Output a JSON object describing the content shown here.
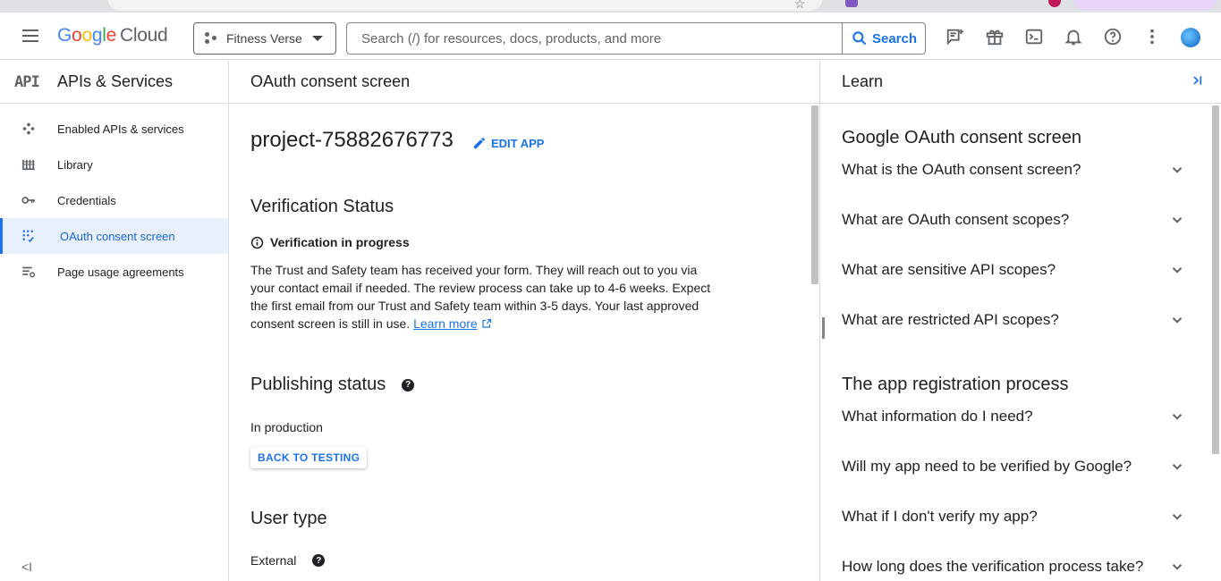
{
  "header": {
    "logo_google": [
      "G",
      "o",
      "o",
      "g",
      "l",
      "e"
    ],
    "logo_cloud": "Cloud",
    "project_name": "Fitness Verse",
    "search_placeholder": "Search (/) for resources, docs, products, and more",
    "search_button": "Search"
  },
  "sidenav": {
    "title": "APIs & Services",
    "api_glyph": "API",
    "items": [
      {
        "label": "Enabled APIs & services",
        "icon": "hub-icon"
      },
      {
        "label": "Library",
        "icon": "library-icon"
      },
      {
        "label": "Credentials",
        "icon": "key-icon"
      },
      {
        "label": "OAuth consent screen",
        "icon": "consent-icon",
        "active": true
      },
      {
        "label": "Page usage agreements",
        "icon": "settings-list-icon"
      }
    ],
    "collapse_glyph": "<I"
  },
  "main": {
    "page_title": "OAuth consent screen",
    "app_name": "project-75882676773",
    "edit_app": "EDIT APP",
    "verification_heading": "Verification Status",
    "verification_state": "Verification in progress",
    "verification_text": "The Trust and Safety team has received your form. They will reach out to you via your contact email if needed. The review process can take up to 4-6 weeks. Expect the first email from our Trust and Safety team within 3-5 days. Your last approved consent screen is still in use.",
    "learn_more": "Learn more",
    "publishing_heading": "Publishing status",
    "publishing_state": "In production",
    "back_to_testing": "BACK TO TESTING",
    "user_type_heading": "User type",
    "user_type_value": "External"
  },
  "learn": {
    "title": "Learn",
    "sections": [
      {
        "title": "Google OAuth consent screen",
        "items": [
          "What is the OAuth consent screen?",
          "What are OAuth consent scopes?",
          "What are sensitive API scopes?",
          "What are restricted API scopes?"
        ]
      },
      {
        "title": "The app registration process",
        "items": [
          "What information do I need?",
          "Will my app need to be verified by Google?",
          "What if I don't verify my app?",
          "How long does the verification process take?"
        ]
      }
    ]
  },
  "colors": {
    "accent": "#1a73e8",
    "active_bg": "#e8f0fe",
    "border": "#dadce0"
  }
}
